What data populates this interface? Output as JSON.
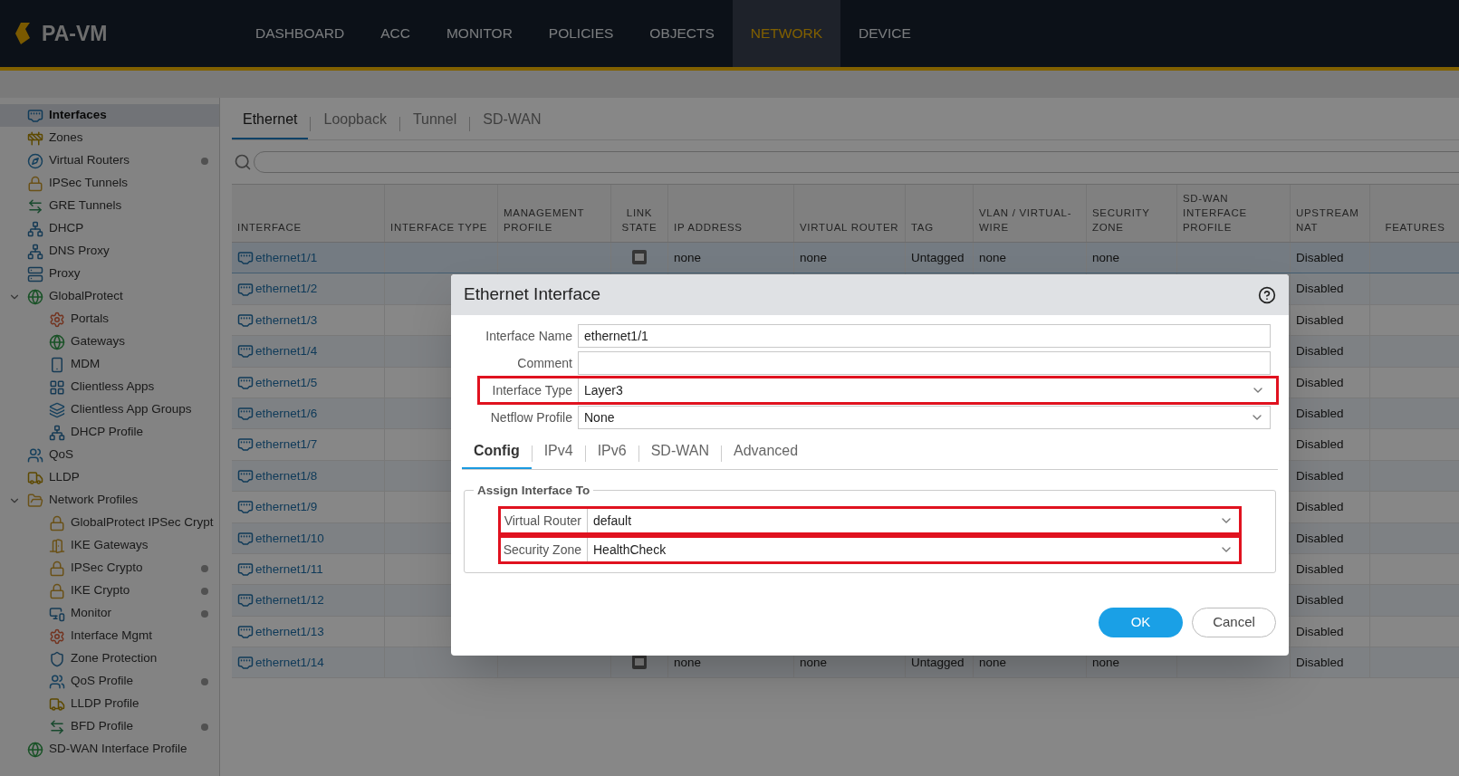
{
  "app": {
    "name": "PA-VM"
  },
  "nav": [
    {
      "label": "DASHBOARD",
      "selected": false
    },
    {
      "label": "ACC",
      "selected": false
    },
    {
      "label": "MONITOR",
      "selected": false
    },
    {
      "label": "POLICIES",
      "selected": false
    },
    {
      "label": "OBJECTS",
      "selected": false
    },
    {
      "label": "NETWORK",
      "selected": true
    },
    {
      "label": "DEVICE",
      "selected": false
    }
  ],
  "sidebar": {
    "items": [
      {
        "label": "Interfaces",
        "kind": "port",
        "selected": true,
        "dot": false
      },
      {
        "label": "Zones",
        "kind": "barrier",
        "selected": false,
        "dot": false
      },
      {
        "label": "Virtual Routers",
        "kind": "router",
        "selected": false,
        "dot": true
      },
      {
        "label": "IPSec Tunnels",
        "kind": "lock",
        "selected": false,
        "dot": false
      },
      {
        "label": "GRE Tunnels",
        "kind": "tunnel",
        "selected": false,
        "dot": false
      },
      {
        "label": "DHCP",
        "kind": "network",
        "selected": false,
        "dot": false
      },
      {
        "label": "DNS Proxy",
        "kind": "network",
        "selected": false,
        "dot": false
      },
      {
        "label": "Proxy",
        "kind": "server",
        "selected": false,
        "dot": false
      },
      {
        "label": "GlobalProtect",
        "kind": "globe",
        "selected": false,
        "dot": false,
        "expanded": true,
        "children": [
          {
            "label": "Portals",
            "kind": "gear",
            "selected": false,
            "dot": false
          },
          {
            "label": "Gateways",
            "kind": "globe",
            "selected": false,
            "dot": false
          },
          {
            "label": "MDM",
            "kind": "phone",
            "selected": false,
            "dot": false
          },
          {
            "label": "Clientless Apps",
            "kind": "grid",
            "selected": false,
            "dot": false
          },
          {
            "label": "Clientless App Groups",
            "kind": "layers",
            "selected": false,
            "dot": false
          },
          {
            "label": "DHCP Profile",
            "kind": "network",
            "selected": false,
            "dot": false
          }
        ]
      },
      {
        "label": "QoS",
        "kind": "qos",
        "selected": false,
        "dot": false
      },
      {
        "label": "LLDP",
        "kind": "truck",
        "selected": false,
        "dot": false
      },
      {
        "label": "Network Profiles",
        "kind": "folder",
        "selected": false,
        "dot": false,
        "expanded": true,
        "children": [
          {
            "label": "GlobalProtect IPSec Crypt",
            "kind": "lock",
            "selected": false,
            "dot": false
          },
          {
            "label": "IKE Gateways",
            "kind": "gate",
            "selected": false,
            "dot": false
          },
          {
            "label": "IPSec Crypto",
            "kind": "lock",
            "selected": false,
            "dot": true
          },
          {
            "label": "IKE Crypto",
            "kind": "lock",
            "selected": false,
            "dot": true
          },
          {
            "label": "Monitor",
            "kind": "monitor",
            "selected": false,
            "dot": true
          },
          {
            "label": "Interface Mgmt",
            "kind": "gear",
            "selected": false,
            "dot": false
          },
          {
            "label": "Zone Protection",
            "kind": "shield",
            "selected": false,
            "dot": false
          },
          {
            "label": "QoS Profile",
            "kind": "qos",
            "selected": false,
            "dot": true
          },
          {
            "label": "LLDP Profile",
            "kind": "truck",
            "selected": false,
            "dot": false
          },
          {
            "label": "BFD Profile",
            "kind": "tunnel",
            "selected": false,
            "dot": true
          }
        ]
      },
      {
        "label": "SD-WAN Interface Profile",
        "kind": "globe",
        "selected": false,
        "dot": false
      }
    ]
  },
  "tabs": [
    {
      "label": "Ethernet",
      "selected": true
    },
    {
      "label": "Loopback",
      "selected": false
    },
    {
      "label": "Tunnel",
      "selected": false
    },
    {
      "label": "SD-WAN",
      "selected": false
    }
  ],
  "table": {
    "columns": [
      "INTERFACE",
      "INTERFACE TYPE",
      "MANAGEMENT PROFILE",
      "LINK STATE",
      "IP ADDRESS",
      "VIRTUAL ROUTER",
      "TAG",
      "VLAN / VIRTUAL-WIRE",
      "SECURITY ZONE",
      "SD-WAN INTERFACE PROFILE",
      "UPSTREAM NAT",
      "FEATURES"
    ],
    "rows": [
      {
        "interface": "ethernet1/1",
        "ip_address": "none",
        "virtual_router": "none",
        "tag": "Untagged",
        "vlan": "none",
        "security_zone": "none",
        "upstream_nat": "Disabled",
        "selected": true
      },
      {
        "interface": "ethernet1/2",
        "upstream_nat": "Disabled",
        "selected": false
      },
      {
        "interface": "ethernet1/3",
        "upstream_nat": "Disabled",
        "selected": false
      },
      {
        "interface": "ethernet1/4",
        "upstream_nat": "Disabled",
        "selected": false
      },
      {
        "interface": "ethernet1/5",
        "upstream_nat": "Disabled",
        "selected": false
      },
      {
        "interface": "ethernet1/6",
        "upstream_nat": "Disabled",
        "selected": false
      },
      {
        "interface": "ethernet1/7",
        "upstream_nat": "Disabled",
        "selected": false
      },
      {
        "interface": "ethernet1/8",
        "upstream_nat": "Disabled",
        "selected": false
      },
      {
        "interface": "ethernet1/9",
        "upstream_nat": "Disabled",
        "selected": false
      },
      {
        "interface": "ethernet1/10",
        "upstream_nat": "Disabled",
        "selected": false
      },
      {
        "interface": "ethernet1/11",
        "upstream_nat": "Disabled",
        "selected": false
      },
      {
        "interface": "ethernet1/12",
        "upstream_nat": "Disabled",
        "selected": false
      },
      {
        "interface": "ethernet1/13",
        "upstream_nat": "Disabled",
        "selected": false
      },
      {
        "interface": "ethernet1/14",
        "ip_address": "none",
        "virtual_router": "none",
        "tag": "Untagged",
        "vlan": "none",
        "security_zone": "none",
        "upstream_nat": "Disabled",
        "selected": false
      }
    ]
  },
  "dialog": {
    "title": "Ethernet Interface",
    "fields": [
      {
        "label": "Interface Name",
        "kind": "text",
        "value": "ethernet1/1",
        "highlighted": false
      },
      {
        "label": "Comment",
        "kind": "text",
        "highlighted": false
      },
      {
        "label": "Interface Type",
        "kind": "select",
        "value": "Layer3",
        "highlighted": true
      },
      {
        "label": "Netflow Profile",
        "kind": "select",
        "value": "None",
        "highlighted": false
      }
    ],
    "tabs": [
      {
        "label": "Config",
        "selected": true
      },
      {
        "label": "IPv4",
        "selected": false
      },
      {
        "label": "IPv6",
        "selected": false
      },
      {
        "label": "SD-WAN",
        "selected": false
      },
      {
        "label": "Advanced",
        "selected": false
      }
    ],
    "group": {
      "title": "Assign Interface To",
      "fields": [
        {
          "label": "Virtual Router",
          "kind": "select",
          "value": "default",
          "highlighted": true
        },
        {
          "label": "Security Zone",
          "kind": "select",
          "value": "HealthCheck",
          "highlighted": true
        }
      ]
    },
    "buttons": [
      {
        "label": "OK",
        "kind": "primary"
      },
      {
        "label": "Cancel",
        "kind": "secondary"
      }
    ]
  }
}
